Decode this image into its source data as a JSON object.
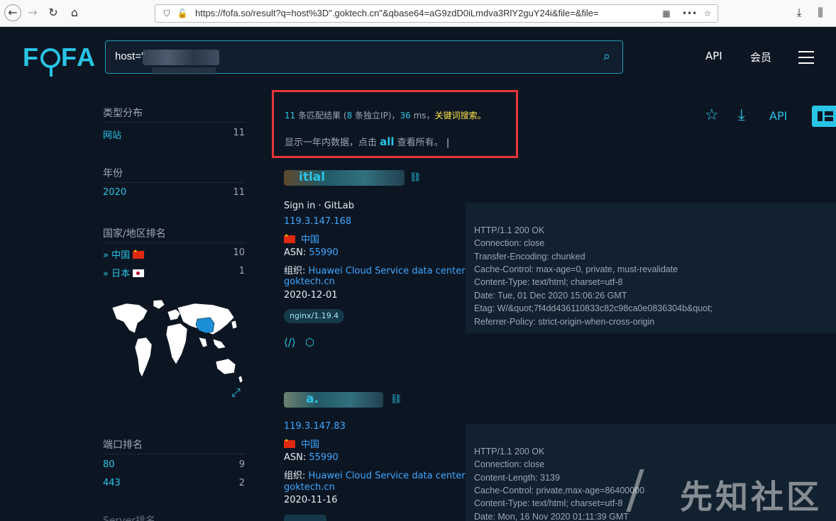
{
  "browser": {
    "url_main": "https://fofa.so/result?q=host%3D\".goktech.cn\"&qbase64=aG9zdD0iLmdva3RlY2guY24i&file=&file=",
    "icons": [
      "back-arrow",
      "forward-arrow",
      "reload",
      "home",
      "shield",
      "lock-warning",
      "qr-code",
      "more",
      "star",
      "download",
      "library"
    ]
  },
  "header": {
    "logo": "FOFA",
    "search_prefix": "host=\"",
    "api_label": "API",
    "member_label": "会员"
  },
  "sidebar": {
    "type_title": "类型分布",
    "type_items": [
      {
        "label": "网站",
        "count": "11"
      }
    ],
    "year_title": "年份",
    "year_items": [
      {
        "label": "2020",
        "count": "11"
      }
    ],
    "country_title": "国家/地区排名",
    "country_items": [
      {
        "label": "中国",
        "count": "10"
      },
      {
        "label": "日本",
        "count": "1"
      }
    ],
    "port_title": "端口排名",
    "port_items": [
      {
        "label": "80",
        "count": "9"
      },
      {
        "label": "443",
        "count": "2"
      }
    ],
    "next_title": "Server排名"
  },
  "summary": {
    "count": "11",
    "text_a": " 条匹配结果 (",
    "unique_ip": "8",
    "text_b": " 条独立IP)，",
    "ms": "36",
    "text_c": " ms，",
    "keyword_link": "关键词搜索。",
    "line2_a": "显示一年内数据，点击 ",
    "all_link": "all",
    "line2_b": " 查看所有。"
  },
  "actions": {
    "api_label": "API"
  },
  "results": [
    {
      "title_visible": "itlal",
      "page_title": "Sign in · GitLab",
      "ip": "119.3.147.168",
      "country": "中国",
      "asn_label": "ASN: ",
      "asn": "55990",
      "org_label": "组织: ",
      "org": "Huawei Cloud Service data center",
      "domain": "goktech.cn",
      "date": "2020-12-01",
      "tag": "nginx/1.19.4",
      "headers": [
        "HTTP/1.1 200 OK",
        "Connection: close",
        "Transfer-Encoding: chunked",
        "Cache-Control: max-age=0, private, must-revalidate",
        "Content-Type: text/html; charset=utf-8",
        "Date: Tue, 01 Dec 2020 15:06:26 GMT",
        "Etag: W/&quot;7f4dd436110833c82c98ca0e0836304b&quot;",
        "Referrer-Policy: strict-origin-when-cross-origin"
      ]
    },
    {
      "title_visible": "a.",
      "ip": "119.3.147.83",
      "country": "中国",
      "asn_label": "ASN: ",
      "asn": "55990",
      "org_label": "组织: ",
      "org": "Huawei Cloud Service data center",
      "domain": "goktech.cn",
      "date": "2020-11-16",
      "headers": [
        "HTTP/1.1 200 OK",
        "Connection: close",
        "Content-Length: 3139",
        "Cache-Control: private,max-age=86400000",
        "Content-Type: text/html; charset=utf-8",
        "Date: Mon, 16 Nov 2020 01:11:39 GMT"
      ]
    }
  ],
  "watermark": "先知社区"
}
